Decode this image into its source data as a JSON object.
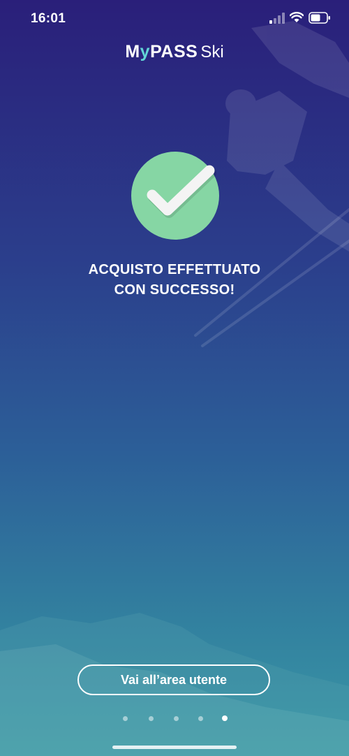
{
  "status_bar": {
    "time": "16:01"
  },
  "logo": {
    "brand_prefix": "M",
    "brand_y": "y",
    "brand_suffix": "PASS",
    "product": "Ski"
  },
  "success": {
    "icon": "checkmark-icon",
    "line1": "ACQUISTO EFFETTUATO",
    "line2": "CON SUCCESSO!"
  },
  "actions": {
    "user_area_label": "Vai all’area utente"
  },
  "pagination": {
    "total": 5,
    "active_index": 4
  },
  "colors": {
    "success_green": "#86d6a4",
    "logo_accent": "#62d6d6",
    "gradient_top": "#2a1f7a",
    "gradient_bottom": "#3a98a6"
  }
}
